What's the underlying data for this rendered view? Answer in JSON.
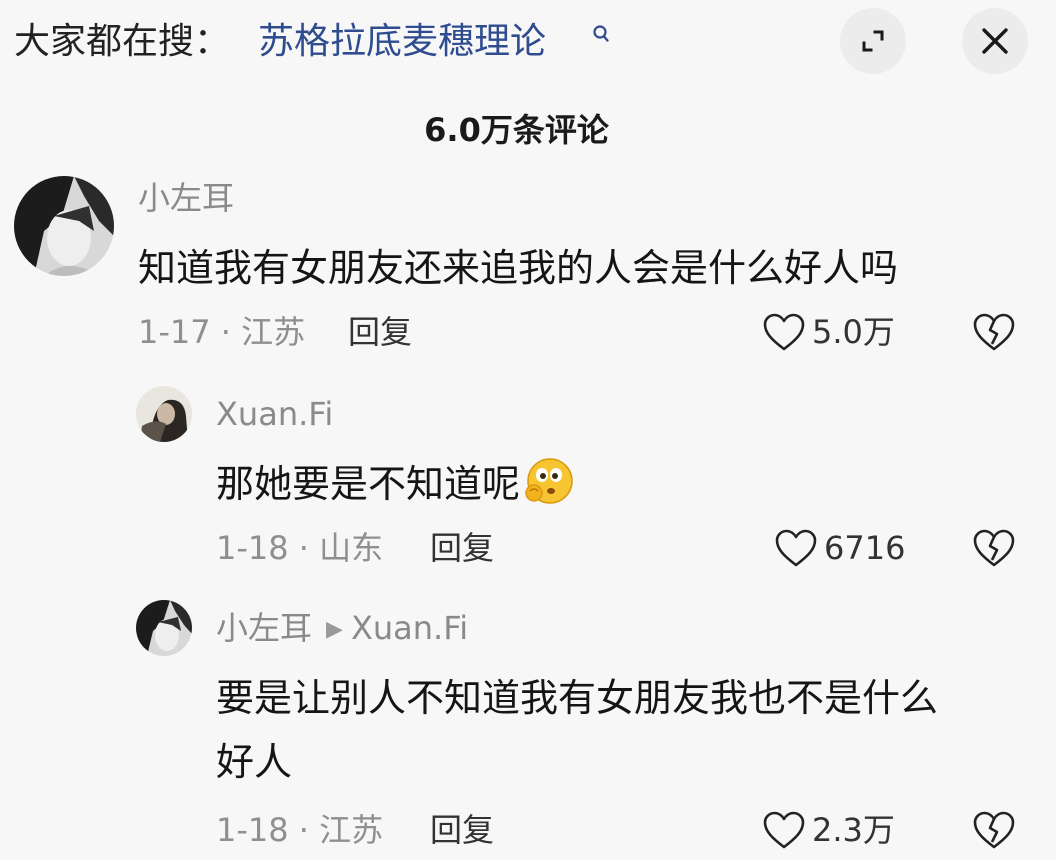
{
  "header": {
    "search_prefix": "大家都在搜：",
    "search_term": "苏格拉底麦穗理论",
    "search_icon": "search-icon",
    "expand_icon": "expand-icon",
    "close_icon": "close-icon"
  },
  "comments_panel": {
    "count_label": "6.0万条评论"
  },
  "comments": [
    {
      "username": "小左耳",
      "text": "知道我有女朋友还来追我的人会是什么好人吗",
      "meta": "1-17 · 江苏",
      "reply_label": "回复",
      "likes": "5.0万"
    },
    {
      "username": "Xuan.Fi",
      "text": "那她要是不知道呢",
      "emoji": "thinking-face-emoji",
      "meta": "1-18 · 山东",
      "reply_label": "回复",
      "likes": "6716"
    },
    {
      "username": "小左耳",
      "reply_to": "Xuan.Fi",
      "text_line1": "要是让别人不知道我有女朋友我也不是什么",
      "text_line2": "好人",
      "meta": "1-18 · 江苏",
      "reply_label": "回复",
      "likes": "2.3万"
    }
  ],
  "colors": {
    "background": "#f7f7f7",
    "link_blue": "#2f4c8f",
    "muted_gray": "#8a8a8a",
    "text_dark": "#151515"
  }
}
